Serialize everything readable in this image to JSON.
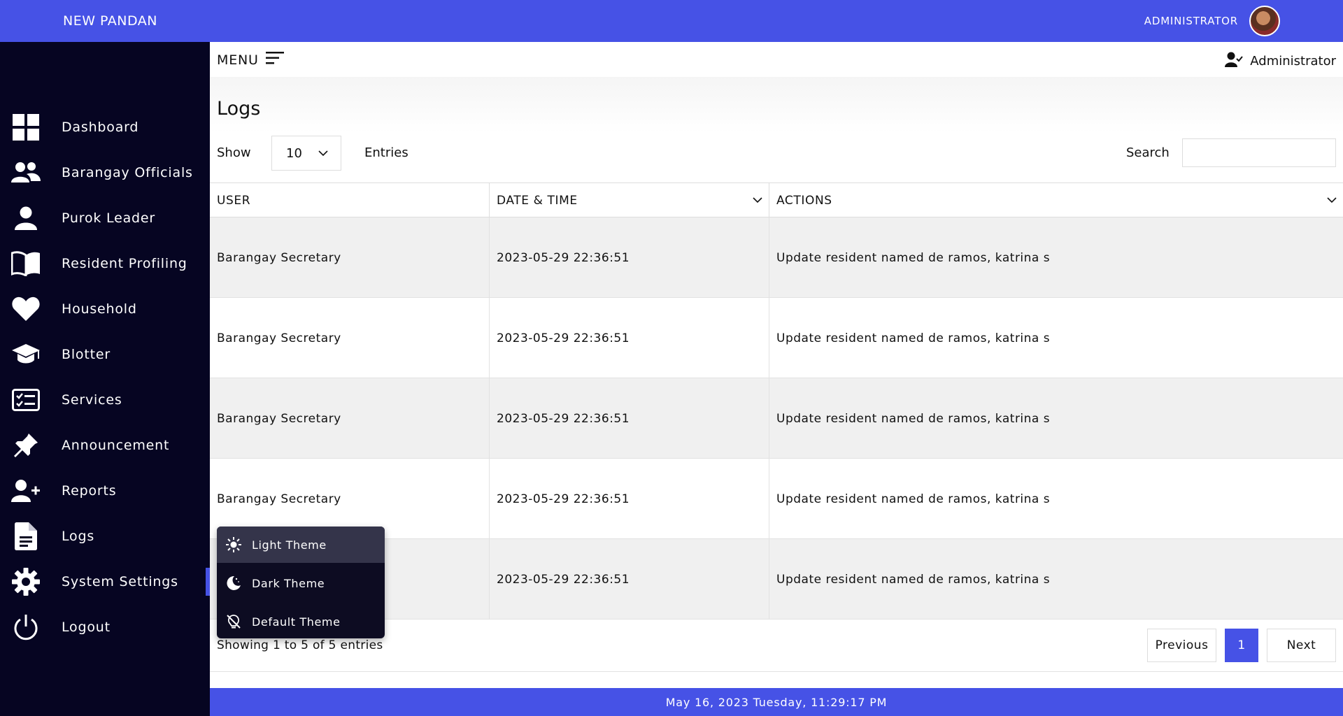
{
  "topbar": {
    "brand": "NEW PANDAN",
    "user_role": "ADMINISTRATOR"
  },
  "sidebar": {
    "items": [
      {
        "label": "Dashboard",
        "icon": "dashboard-grid-icon"
      },
      {
        "label": "Barangay Officials",
        "icon": "users-group-icon"
      },
      {
        "label": "Purok Leader",
        "icon": "user-icon"
      },
      {
        "label": "Resident Profiling",
        "icon": "book-icon"
      },
      {
        "label": "Household",
        "icon": "heart-icon"
      },
      {
        "label": "Blotter",
        "icon": "graduation-cap-icon"
      },
      {
        "label": "Services",
        "icon": "checklist-icon"
      },
      {
        "label": "Announcement",
        "icon": "pin-icon"
      },
      {
        "label": "Reports",
        "icon": "user-plus-icon"
      },
      {
        "label": "Logs",
        "icon": "document-icon"
      },
      {
        "label": "System Settings",
        "icon": "gear-icon"
      },
      {
        "label": "Logout",
        "icon": "power-icon"
      }
    ],
    "active": "System Settings"
  },
  "subheader": {
    "menu_label": "MENU",
    "user_name": "Administrator"
  },
  "page": {
    "title": "Logs",
    "show_label": "Show",
    "entries_value": "10",
    "entries_label": "Entries",
    "search_label": "Search",
    "search_value": ""
  },
  "table": {
    "columns": [
      "USER",
      "DATE & TIME",
      "ACTIONS"
    ],
    "rows": [
      [
        "Barangay Secretary",
        "2023-05-29 22:36:51",
        "Update resident named de ramos, katrina s"
      ],
      [
        "Barangay Secretary",
        "2023-05-29 22:36:51",
        "Update resident named de ramos, katrina s"
      ],
      [
        "Barangay Secretary",
        "2023-05-29 22:36:51",
        "Update resident named de ramos, katrina s"
      ],
      [
        "Barangay Secretary",
        "2023-05-29 22:36:51",
        "Update resident named de ramos, katrina s"
      ],
      [
        "Barangay Secretary",
        "2023-05-29 22:36:51",
        "Update resident named de ramos, katrina s"
      ]
    ]
  },
  "pagination": {
    "summary": "Showing 1 to 5 of 5 entries",
    "previous": "Previous",
    "current": "1",
    "next": "Next"
  },
  "theme_menu": {
    "items": [
      {
        "label": "Light Theme",
        "icon": "sun-icon"
      },
      {
        "label": "Dark Theme",
        "icon": "moon-icon"
      },
      {
        "label": "Default Theme",
        "icon": "lightbulb-off-icon"
      }
    ],
    "highlighted": "Light Theme"
  },
  "footer": {
    "datetime": "May 16, 2023 Tuesday, 11:29:17 PM"
  },
  "colors": {
    "accent": "#4652e6",
    "sidebar_bg": "#060522",
    "row_stripe": "#f0f0f0"
  }
}
